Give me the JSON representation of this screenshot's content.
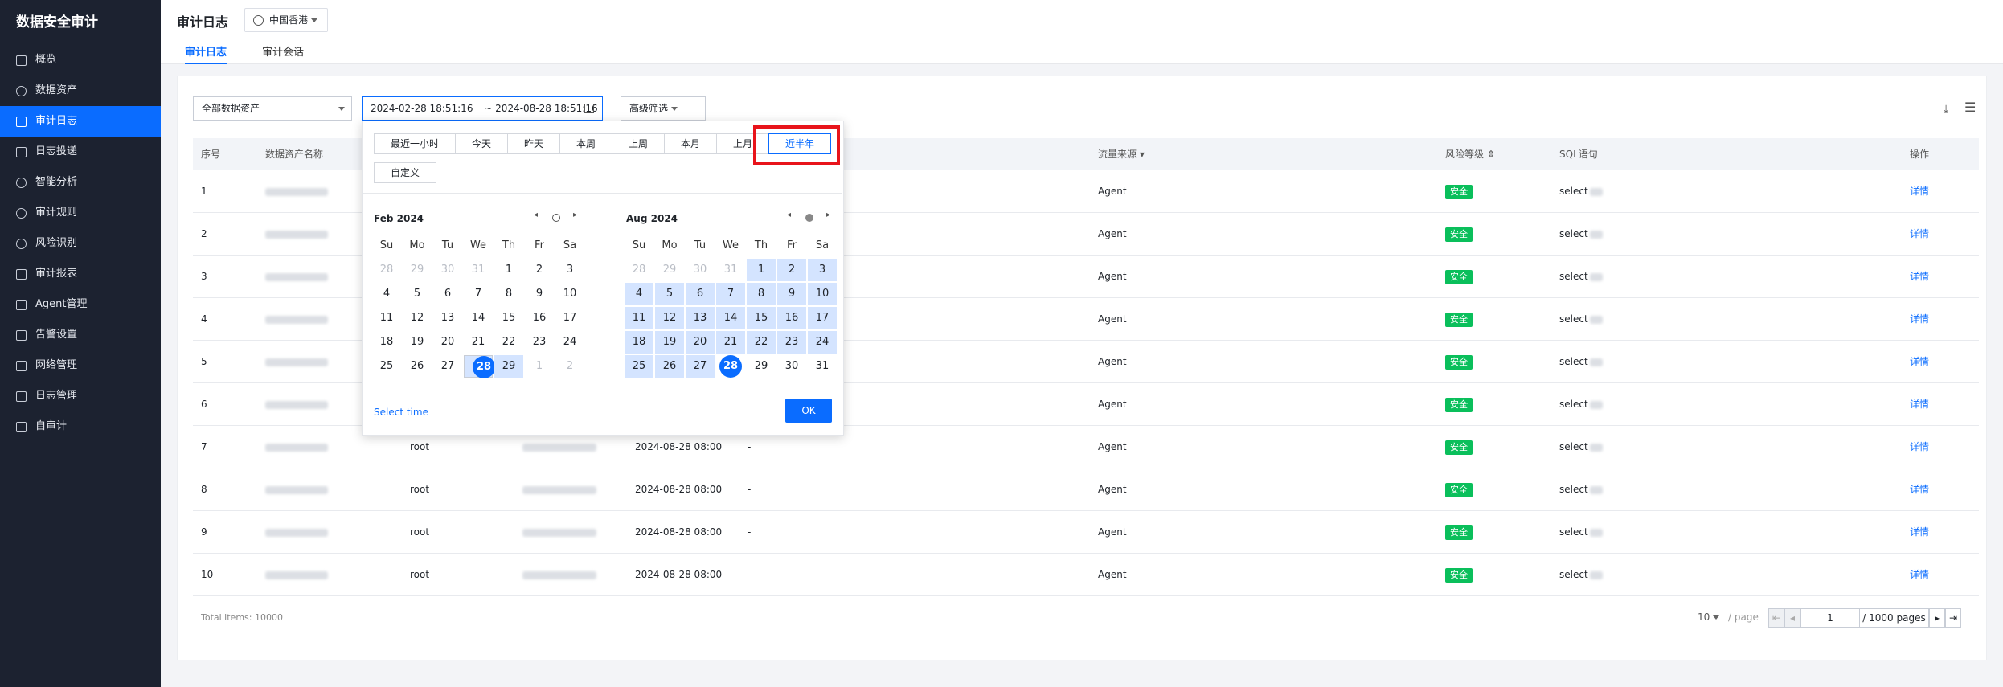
{
  "sidebar": {
    "brand": "数据安全审计",
    "items": [
      {
        "label": "概览"
      },
      {
        "label": "数据资产"
      },
      {
        "label": "审计日志"
      },
      {
        "label": "日志投递"
      },
      {
        "label": "智能分析"
      },
      {
        "label": "审计规则"
      },
      {
        "label": "风险识别"
      },
      {
        "label": "审计报表"
      },
      {
        "label": "Agent管理"
      },
      {
        "label": "告警设置"
      },
      {
        "label": "网络管理"
      },
      {
        "label": "日志管理"
      },
      {
        "label": "自审计"
      }
    ]
  },
  "header": {
    "title": "审计日志",
    "region": "中国香港",
    "tabs": [
      "审计日志",
      "审计会话"
    ]
  },
  "filters": {
    "asset": "全部数据资产",
    "start": "2024-02-28 18:51:16",
    "end": "2024-08-28 18:51:16",
    "sep": "~",
    "advanced": "高级筛选"
  },
  "table": {
    "columns": [
      "序号",
      "数据资产名称",
      "流量来源",
      "风险等级",
      "SQL语句",
      "操作"
    ],
    "rows": [
      {
        "no": "1",
        "user": "",
        "time": "",
        "extra": "",
        "source": "Agent",
        "risk": "安全",
        "sql": "select",
        "op": "详情"
      },
      {
        "no": "2",
        "user": "",
        "time": "",
        "extra": "",
        "source": "Agent",
        "risk": "安全",
        "sql": "select",
        "op": "详情"
      },
      {
        "no": "3",
        "user": "",
        "time": "",
        "extra": "",
        "source": "Agent",
        "risk": "安全",
        "sql": "select",
        "op": "详情"
      },
      {
        "no": "4",
        "user": "",
        "time": "",
        "extra": "",
        "source": "Agent",
        "risk": "安全",
        "sql": "select",
        "op": "详情"
      },
      {
        "no": "5",
        "user": "",
        "time": "",
        "extra": "",
        "source": "Agent",
        "risk": "安全",
        "sql": "select",
        "op": "详情"
      },
      {
        "no": "6",
        "user": "",
        "time": "",
        "extra": "",
        "source": "Agent",
        "risk": "安全",
        "sql": "select",
        "op": "详情"
      },
      {
        "no": "7",
        "user": "root",
        "time": "2024-08-28 08:00",
        "extra": "-",
        "source": "Agent",
        "risk": "安全",
        "sql": "select",
        "op": "详情"
      },
      {
        "no": "8",
        "user": "root",
        "time": "2024-08-28 08:00",
        "extra": "-",
        "source": "Agent",
        "risk": "安全",
        "sql": "select",
        "op": "详情"
      },
      {
        "no": "9",
        "user": "root",
        "time": "2024-08-28 08:00",
        "extra": "-",
        "source": "Agent",
        "risk": "安全",
        "sql": "select",
        "op": "详情"
      },
      {
        "no": "10",
        "user": "root",
        "time": "2024-08-28 08:00",
        "extra": "-",
        "source": "Agent",
        "risk": "安全",
        "sql": "select",
        "op": "详情"
      }
    ]
  },
  "picker": {
    "quick": [
      "最近一小时",
      "今天",
      "昨天",
      "本周",
      "上周",
      "本月",
      "上月",
      "近半年",
      "自定义"
    ],
    "left_title": "Feb 2024",
    "right_title": "Aug 2024",
    "dow": [
      "Su",
      "Mo",
      "Tu",
      "We",
      "Th",
      "Fr",
      "Sa"
    ],
    "left_days": [
      "28",
      "29",
      "30",
      "31",
      "1",
      "2",
      "3",
      "4",
      "5",
      "6",
      "7",
      "8",
      "9",
      "10",
      "11",
      "12",
      "13",
      "14",
      "15",
      "16",
      "17",
      "18",
      "19",
      "20",
      "21",
      "22",
      "23",
      "24",
      "25",
      "26",
      "27",
      "28",
      "29",
      "1",
      "2"
    ],
    "right_days": [
      "28",
      "29",
      "30",
      "31",
      "1",
      "2",
      "3",
      "4",
      "5",
      "6",
      "7",
      "8",
      "9",
      "10",
      "11",
      "12",
      "13",
      "14",
      "15",
      "16",
      "17",
      "18",
      "19",
      "20",
      "21",
      "22",
      "23",
      "24",
      "25",
      "26",
      "27",
      "28",
      "29",
      "30",
      "31"
    ],
    "select_time": "Select time",
    "ok": "OK"
  },
  "footer": {
    "total": "Total items: 10000",
    "page_size": "10",
    "per_page": "/ page",
    "current": "1",
    "pages": "/ 1000 pages"
  }
}
